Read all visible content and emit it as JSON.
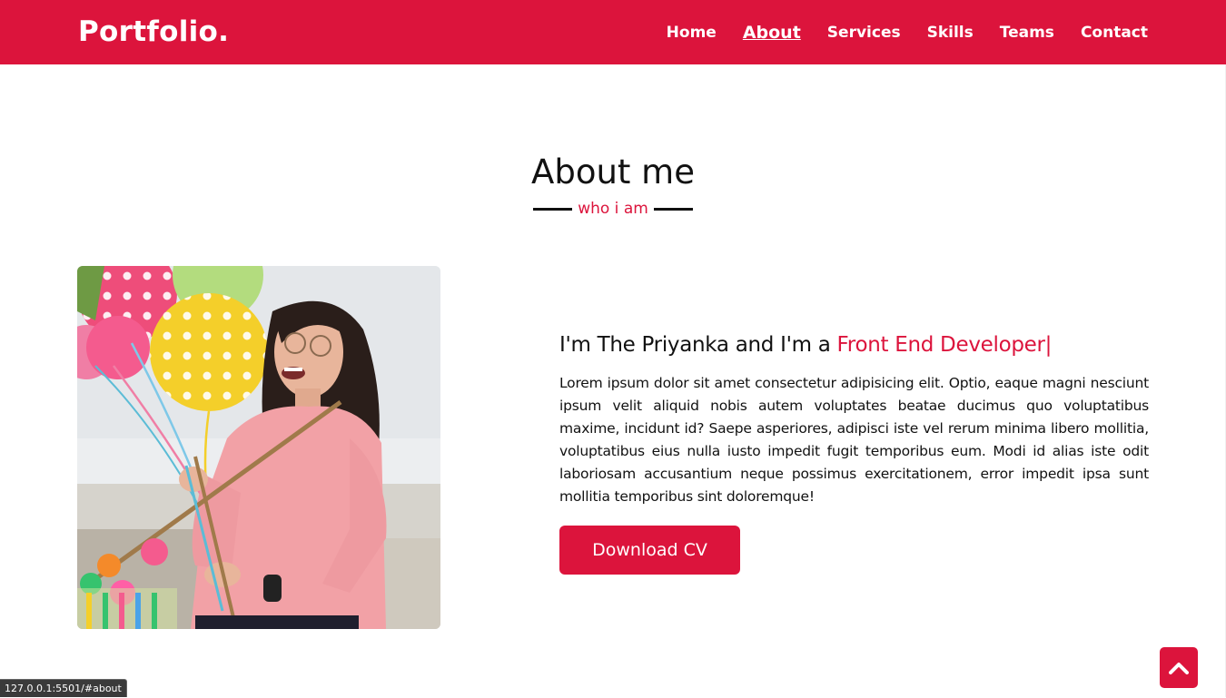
{
  "brand": {
    "logo": "Portfolio.",
    "accent_color": "#dc143c"
  },
  "nav": {
    "items": [
      {
        "label": "Home",
        "active": false
      },
      {
        "label": "About",
        "active": true
      },
      {
        "label": "Services",
        "active": false
      },
      {
        "label": "Skills",
        "active": false
      },
      {
        "label": "Teams",
        "active": false
      },
      {
        "label": "Contact",
        "active": false
      }
    ]
  },
  "about": {
    "title": "About me",
    "subtitle": "who i am",
    "headline_prefix": "I'm The Priyanka and I'm a",
    "headline_accent": "Front End Developer|",
    "description": "Lorem ipsum dolor sit amet consectetur adipisicing elit. Optio, eaque magni nesciunt ipsum velit aliquid nobis autem voluptates beatae ducimus quo voluptatibus maxime, incidunt id? Saepe asperiores, adipisci iste vel rerum minima libero mollitia, voluptatibus eius nulla iusto impedit fugit temporibus eum. Modi id alias iste odit laboriosam accusantium neque possimus exercitationem, error impedit ipsa sunt mollitia temporibus sint doloremque!",
    "button_label": "Download CV"
  },
  "icons": {
    "scroll_top": "chevron-up-icon"
  },
  "status_bar": {
    "url": "127.0.0.1:5501/#about"
  }
}
